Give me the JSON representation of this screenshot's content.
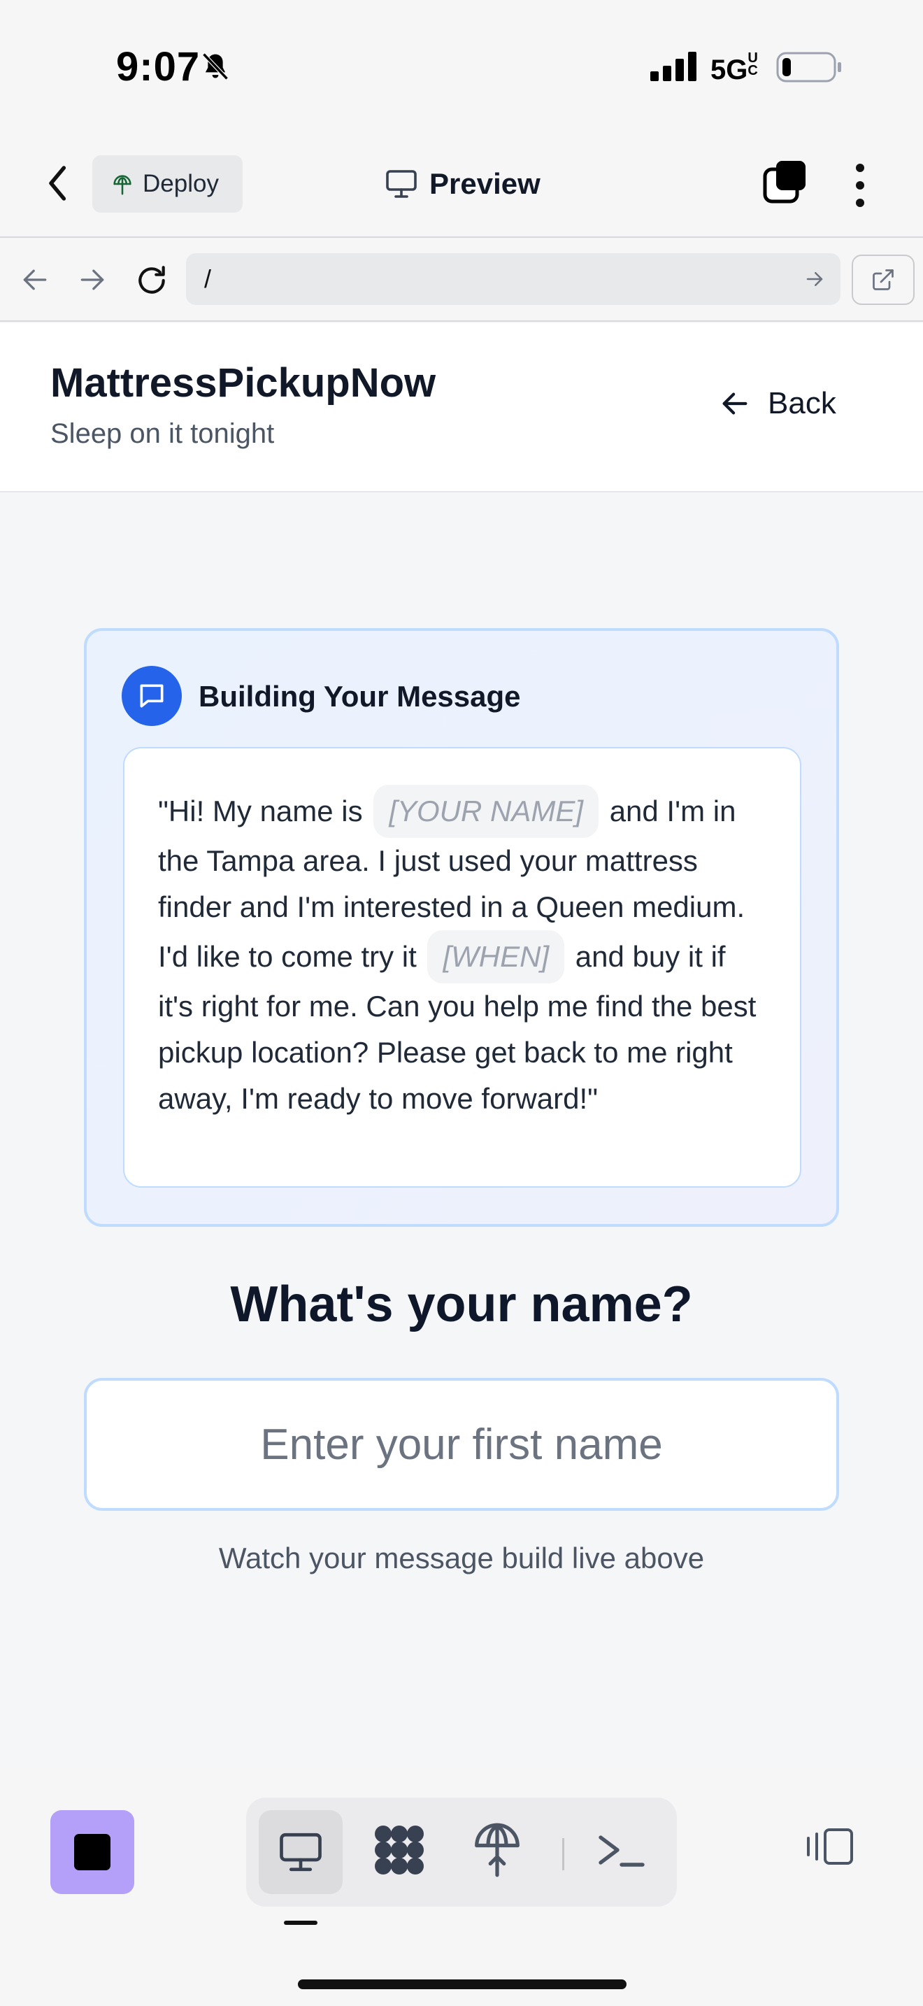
{
  "status_bar": {
    "time": "9:07",
    "network": "5G UC",
    "battery_percent": 15
  },
  "toolbar": {
    "deploy_label": "Deploy",
    "preview_label": "Preview"
  },
  "browser": {
    "url": "/"
  },
  "site": {
    "title": "MattressPickupNow",
    "tagline": "Sleep on it tonight",
    "back_label": "Back"
  },
  "card": {
    "title": "Building Your Message",
    "message": {
      "part1": "\"Hi! My name is",
      "name_placeholder": "[YOUR NAME]",
      "part2": "and I'm in the Tampa area. I just used your mattress finder and I'm interested in a Queen medium. I'd like to come try it",
      "when_placeholder": "[WHEN]",
      "part3": "and buy it if it's right for me. Can you help me find the best pickup location? Please get back to me right away, I'm ready to move forward!\""
    }
  },
  "form": {
    "question": "What's your name?",
    "placeholder": "Enter your first name",
    "value": "",
    "hint": "Watch your message build live above"
  },
  "colors": {
    "accent": "#2563eb",
    "stop_button": "#b4a0f8",
    "card_border": "#bfdbfe"
  },
  "icons": {
    "status": [
      "bell-slash-icon",
      "signal-icon",
      "battery-icon"
    ],
    "toolbar": [
      "chevron-left-icon",
      "deploy-icon",
      "monitor-icon",
      "tabs-icon",
      "more-vertical-icon"
    ],
    "browser": [
      "arrow-left-icon",
      "arrow-right-icon",
      "reload-icon",
      "external-link-icon"
    ],
    "bottom": [
      "stop-icon",
      "monitor-icon",
      "grid-icon",
      "deploy-icon",
      "terminal-icon",
      "layout-toggle-icon"
    ]
  }
}
